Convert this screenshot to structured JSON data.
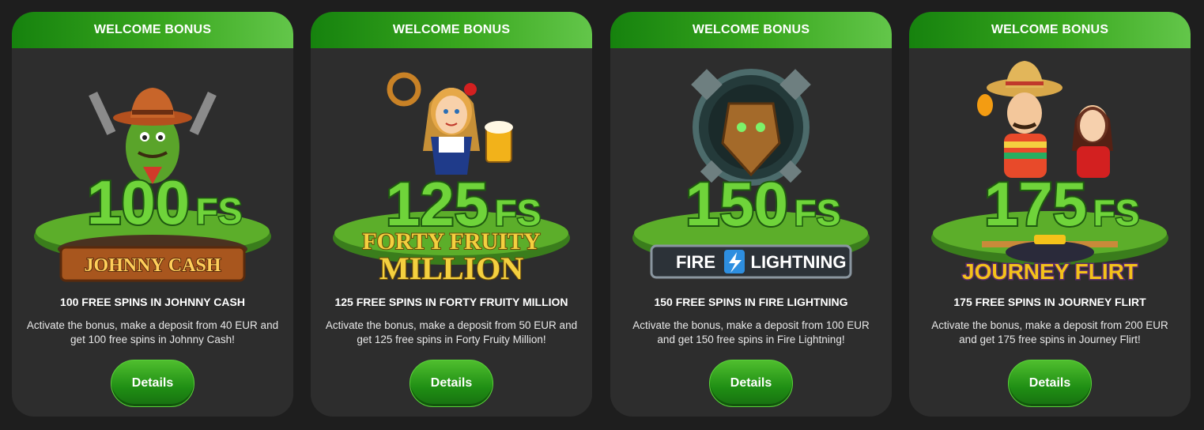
{
  "cards": [
    {
      "header": "WELCOME BONUS",
      "art": {
        "big_number": "100",
        "big_suffix": "FS",
        "game_logo_line1": "JOHNNY CASH",
        "game_logo_line2": ""
      },
      "title": "100 FREE SPINS IN JOHNNY CASH",
      "description": "Activate the bonus, make a deposit from 40 EUR and get 100 free spins in Johnny Cash!",
      "button": "Details"
    },
    {
      "header": "WELCOME BONUS",
      "art": {
        "big_number": "125",
        "big_suffix": "FS",
        "game_logo_line1": "FORTY FRUITY",
        "game_logo_line2": "MILLION"
      },
      "title": "125 FREE SPINS IN FORTY FRUITY MILLION",
      "description": "Activate the bonus, make a deposit from 50 EUR and get 125 free spins in Forty Fruity Million!",
      "button": "Details"
    },
    {
      "header": "WELCOME BONUS",
      "art": {
        "big_number": "150",
        "big_suffix": "FS",
        "game_logo_line1": "FIRE",
        "game_logo_line2": "LIGHTNING"
      },
      "title": "150 FREE SPINS IN FIRE LIGHTNING",
      "description": "Activate the bonus, make a deposit from 100 EUR and get 150 free spins in Fire Lightning!",
      "button": "Details"
    },
    {
      "header": "WELCOME BONUS",
      "art": {
        "big_number": "175",
        "big_suffix": "FS",
        "game_logo_line1": "JOURNEY FLIRT",
        "game_logo_line2": ""
      },
      "title": "175 FREE SPINS IN JOURNEY FLIRT",
      "description": "Activate the bonus, make a deposit from 200 EUR and get 175 free spins in Journey Flirt!",
      "button": "Details"
    }
  ],
  "colors": {
    "page_bg": "#1e1e1e",
    "card_bg": "#2d2d2d",
    "header_green_start": "#16820e",
    "header_green_end": "#63c64a",
    "button_green": "#2a9a1a",
    "number_green": "#6fd43a"
  },
  "icons": [
    "cactus-cowboy-art",
    "bavarian-girl-art",
    "viking-mask-art",
    "mexican-couple-art"
  ]
}
